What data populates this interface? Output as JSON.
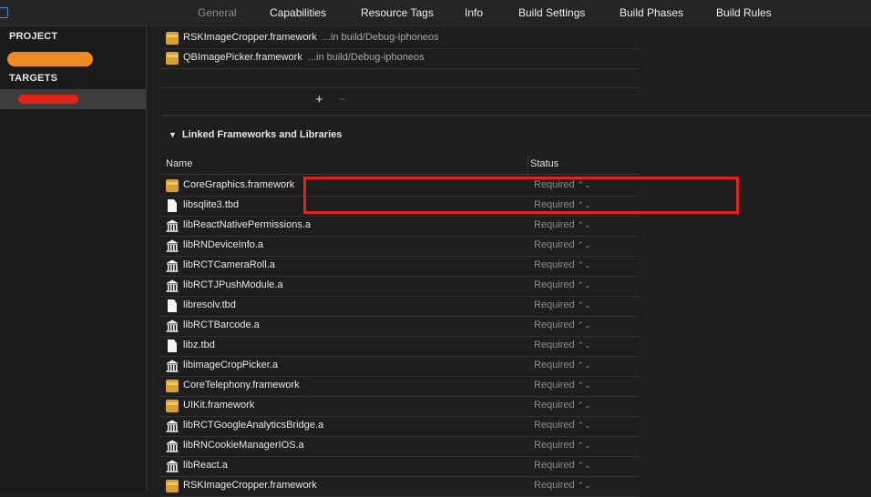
{
  "tabs": [
    {
      "label": "General",
      "selected": true
    },
    {
      "label": "Capabilities"
    },
    {
      "label": "Resource Tags"
    },
    {
      "label": "Info"
    },
    {
      "label": "Build Settings"
    },
    {
      "label": "Build Phases"
    },
    {
      "label": "Build Rules"
    }
  ],
  "sidebar": {
    "project_heading": "PROJECT",
    "targets_heading": "TARGETS",
    "redaction_colors": {
      "project": "#f08a24",
      "target": "#e2231a"
    }
  },
  "embedded": {
    "rows": [
      {
        "name": "RSKImageCropper.framework",
        "path": "...in build/Debug-iphoneos",
        "icon": "framework-icon"
      },
      {
        "name": "QBImagePicker.framework",
        "path": "...in build/Debug-iphoneos",
        "icon": "framework-icon"
      }
    ],
    "add_label": "+",
    "remove_label": "−"
  },
  "linked": {
    "title": "Linked Frameworks and Libraries",
    "disclosure": "▼",
    "columns": {
      "name": "Name",
      "status": "Status"
    },
    "rows": [
      {
        "name": "CoreGraphics.framework",
        "status": "Required",
        "icon": "framework-icon"
      },
      {
        "name": "libsqlite3.tbd",
        "status": "Required",
        "icon": "document-icon"
      },
      {
        "name": "libReactNativePermissions.a",
        "status": "Required",
        "icon": "library-icon"
      },
      {
        "name": "libRNDeviceInfo.a",
        "status": "Required",
        "icon": "library-icon"
      },
      {
        "name": "libRCTCameraRoll.a",
        "status": "Required",
        "icon": "library-icon"
      },
      {
        "name": "libRCTJPushModule.a",
        "status": "Required",
        "icon": "library-icon"
      },
      {
        "name": "libresolv.tbd",
        "status": "Required",
        "icon": "document-icon"
      },
      {
        "name": "libRCTBarcode.a",
        "status": "Required",
        "icon": "library-icon"
      },
      {
        "name": "libz.tbd",
        "status": "Required",
        "icon": "document-icon"
      },
      {
        "name": "libimageCropPicker.a",
        "status": "Required",
        "icon": "library-icon"
      },
      {
        "name": "CoreTelephony.framework",
        "status": "Required",
        "icon": "framework-icon"
      },
      {
        "name": "UIKit.framework",
        "status": "Required",
        "icon": "framework-icon"
      },
      {
        "name": "libRCTGoogleAnalyticsBridge.a",
        "status": "Required",
        "icon": "library-icon"
      },
      {
        "name": "libRNCookieManagerIOS.a",
        "status": "Required",
        "icon": "library-icon"
      },
      {
        "name": "libReact.a",
        "status": "Required",
        "icon": "library-icon"
      },
      {
        "name": "RSKImageCropper.framework",
        "status": "Required",
        "icon": "framework-icon"
      }
    ],
    "stepper_glyph": "⌃⌄",
    "highlight_color": "#e2231a"
  }
}
